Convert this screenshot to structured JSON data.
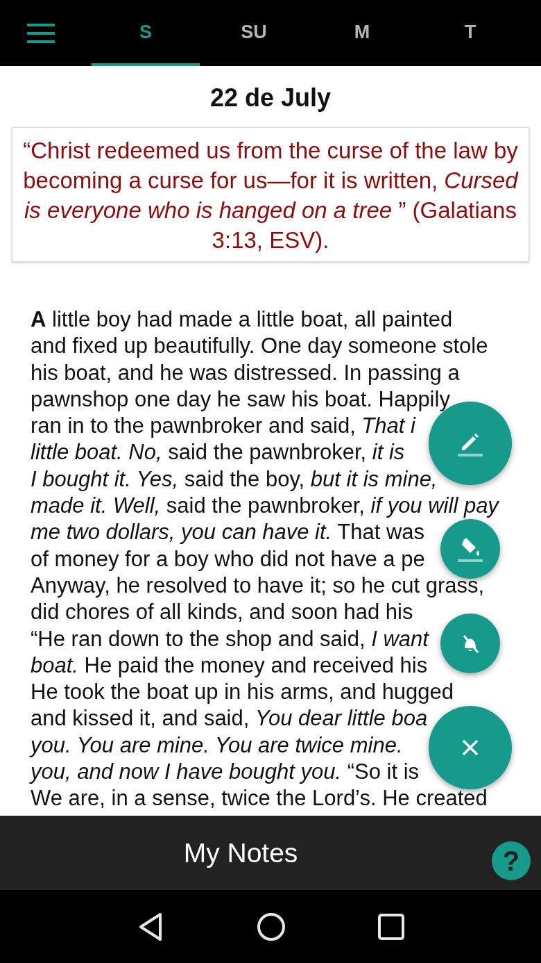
{
  "tabs": [
    {
      "label": "S",
      "selected": true
    },
    {
      "label": "SU",
      "selected": false
    },
    {
      "label": "M",
      "selected": false
    },
    {
      "label": "T",
      "selected": false
    }
  ],
  "date": "22 de July",
  "verse": "“Christ redeemed us from the curse of the law by becoming a curse for us—for it is written, *Cursed is everyone who is hanged on a tree* ” (Galatians 3:13, ESV).",
  "story_lines": [
    "**A** little boy had made a little boat, all painted",
    "and fixed up beautifully. One day someone stole",
    "his boat, and he was distressed. In passing a",
    "pawnshop one day he saw his boat. Happily",
    "ran in to the pawnbroker and said, *That i*",
    "*little boat. No,* said the pawnbroker, *it is*",
    "*I bought it. Yes,* said the boy, *but it is mine,*",
    "*made it. Well,* said the pawnbroker, *if you will pay*",
    "*me two dollars, you can have it.* That was",
    "of money for a boy who did not have a pe",
    "Anyway, he resolved to have it; so he cut grass,",
    "did chores of all kinds, and soon had his",
    "“He ran down to the shop and said, *I want*",
    "*boat.* He paid the money and received his",
    "He took the boat up in his arms, and hugged",
    "and kissed it, and said, *You dear little boa*",
    "*you. You are mine. You are twice mine.*",
    "*you, and now I have bought you.* “So it is",
    "We are, in a sense, twice the Lord’s. He created"
  ],
  "bottom_bar": {
    "title": "My Notes",
    "help": "?"
  }
}
